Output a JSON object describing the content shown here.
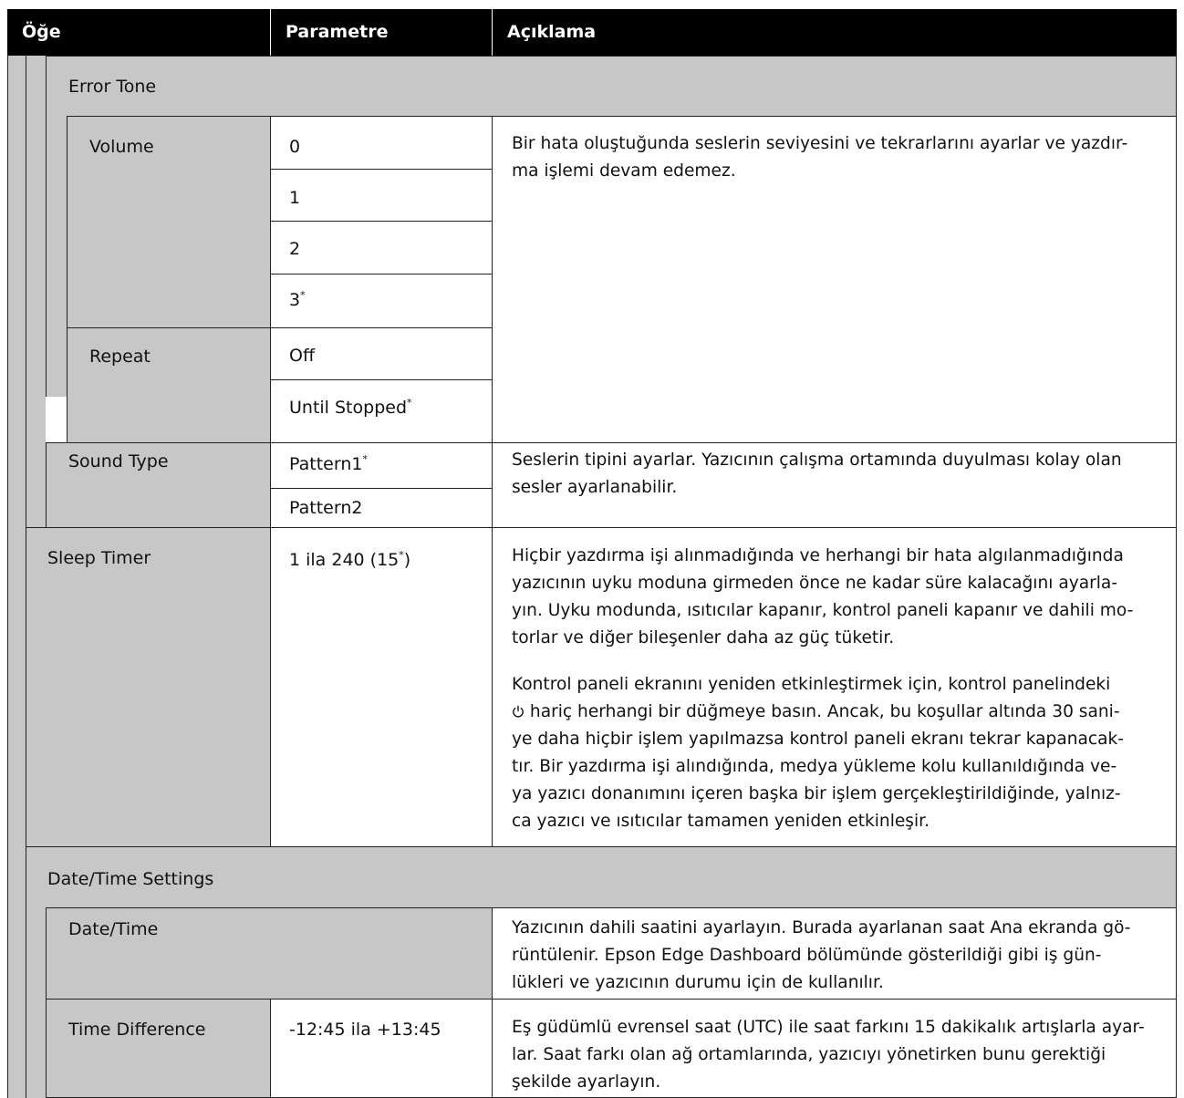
{
  "header": {
    "col_item": "Öğe",
    "col_param": "Parametre",
    "col_desc": "Açıklama"
  },
  "rows": {
    "error_tone": {
      "label": "Error Tone",
      "volume": {
        "label": "Volume",
        "values": [
          "0",
          "1",
          "2",
          "3"
        ],
        "default_mark": "*"
      },
      "repeat": {
        "label": "Repeat",
        "values": [
          "Off",
          "Until Stopped"
        ],
        "default_mark": "*"
      },
      "desc": "Bir hata oluştuğunda seslerin seviyesini ve tekrarlarını ayarlar ve yazdır-\nma işlemi devam edemez."
    },
    "sound_type": {
      "label": "Sound Type",
      "values": [
        "Pattern1",
        "Pattern2"
      ],
      "default_mark": "*",
      "desc": "Seslerin tipini ayarlar. Yazıcının çalışma ortamında duyulması kolay olan\nsesler ayarlanabilir."
    },
    "sleep_timer": {
      "label": "Sleep Timer",
      "param_prefix": "1 ila 240 (15",
      "param_mark": "*",
      "param_suffix": ")",
      "desc1": "Hiçbir yazdırma işi alınmadığında ve herhangi bir hata algılanmadığında\nyazıcının uyku moduna girmeden önce ne kadar süre kalacağını ayarla-\nyın. Uyku modunda, ısıtıcılar kapanır, kontrol paneli kapanır ve dahili mo-\ntorlar ve diğer bileşenler daha az güç tüketir.",
      "desc2_a": "Kontrol paneli ekranını yeniden etkinleştirmek için, kontrol panelindeki\n",
      "desc2_b": " hariç herhangi bir düğmeye basın. Ancak, bu koşullar altında 30 sani-\nye daha hiçbir işlem yapılmazsa kontrol paneli ekranı tekrar kapanacak-\ntır. Bir yazdırma işi alındığında, medya yükleme kolu kullanıldığında ve-\nya yazıcı donanımını içeren başka bir işlem gerçekleştirildiğinde, yalnız-\nca yazıcı ve ısıtıcılar tamamen yeniden etkinleşir.",
      "desc2_icon": "power-icon"
    },
    "date_time_settings": {
      "label": "Date/Time Settings"
    },
    "date_time": {
      "label": "Date/Time",
      "desc": "Yazıcının dahili saatini ayarlayın. Burada ayarlanan saat Ana ekranda gö-\nrüntülenir. Epson Edge Dashboard bölümünde gösterildiği gibi iş gün-\nlükleri ve yazıcının durumu için de kullanılır."
    },
    "time_difference": {
      "label": "Time Difference",
      "param": "-12:45 ila +13:45",
      "desc": "Eş güdümlü evrensel saat (UTC) ile saat farkını 15 dakikalık artışlarla ayar-\nlar. Saat farkı olan ağ ortamlarında, yazıcıyı yönetirken bunu gerektiği\nşekilde ayarlayın."
    }
  },
  "colors": {
    "header_bg": "#000000",
    "header_text": "#ffffff",
    "label_bg": "#c7c7c7",
    "border": "#222222"
  }
}
